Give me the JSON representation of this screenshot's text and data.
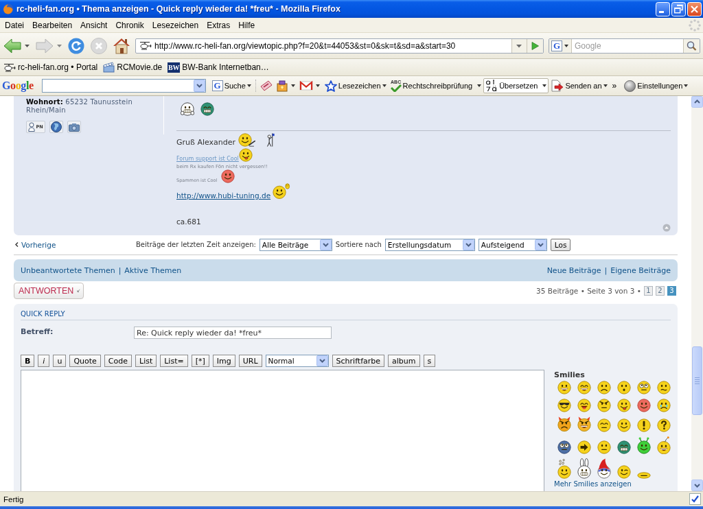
{
  "window": {
    "title": "rc-heli-fan.org • Thema anzeigen - Quick reply wieder da! *freu* - Mozilla Firefox"
  },
  "menu_bar": [
    "Datei",
    "Bearbeiten",
    "Ansicht",
    "Chronik",
    "Lesezeichen",
    "Extras",
    "Hilfe"
  ],
  "nav_toolbar": {
    "url": "http://www.rc-heli-fan.org/viewtopic.php?f=20&t=44053&st=0&sk=t&sd=a&start=30",
    "search": {
      "engine_badge": "G",
      "placeholder": "Google"
    }
  },
  "bookmarks": [
    {
      "kind": "helicopter",
      "label": "rc-heli-fan.org • Portal"
    },
    {
      "kind": "clapper",
      "label": "RCMovie.de"
    },
    {
      "kind": "badge",
      "badge": "BW",
      "label": "BW-Bank Internetban…"
    }
  ],
  "google_toolbar": {
    "logo": "Google",
    "search_badge": "G",
    "search_button": "Suche",
    "buttons": [
      {
        "kind": "star",
        "label": "Lesezeichen",
        "pressed": false
      },
      {
        "kind": "spellcheck",
        "icon_text": "ABC",
        "label": "Rechtschreibprüfung",
        "pressed": false
      },
      {
        "kind": "translate",
        "label": "Übersetzen",
        "pressed": true
      },
      {
        "kind": "send",
        "label": "Senden an",
        "pressed": false
      }
    ],
    "overflow": "»",
    "settings": "Einstellungen"
  },
  "post": {
    "author": {
      "location_label": "Wohnort:",
      "location": "65232 Taunusstein Rhein/Main",
      "contacts": [
        {
          "kind": "pm",
          "label": "PN"
        },
        {
          "kind": "website"
        },
        {
          "kind": "gallery"
        }
      ]
    },
    "smilies": [
      {
        "kind": "thumbs"
      },
      {
        "kind": "mrgreen"
      }
    ],
    "signature": [
      {
        "kind": "text",
        "text": "Gruß Alexander",
        "smilies": [
          {
            "kind": "pen"
          },
          {
            "kind": "flagman"
          }
        ]
      },
      {
        "kind": "small_link",
        "text": "Forum support ist Cool",
        "smilies": [
          {
            "kind": "razz"
          }
        ]
      },
      {
        "kind": "tiny",
        "text": "beim Rx kaufen Fön nicht vergessen!!"
      },
      {
        "kind": "micro",
        "text": "Spammen ist Cool",
        "smilies": [
          {
            "kind": "blush"
          }
        ]
      },
      {
        "kind": "link",
        "text": "http://www.hubi-tuning.de",
        "smilies": [
          {
            "kind": "wave"
          }
        ]
      }
    ],
    "footer": "ca.681"
  },
  "topic_nav": {
    "previous": "Vorherige",
    "filter_label": "Beiträge der letzten Zeit anzeigen:",
    "filter_value": "Alle Beiträge",
    "sort_label": "Sortiere nach",
    "sort_key": "Erstellungsdatum",
    "sort_order": "Aufsteigend",
    "go": "Los"
  },
  "link_bar": {
    "separator": "|",
    "left": [
      "Unbeantwortete Themen",
      "Aktive Themen"
    ],
    "right": [
      "Neue Beiträge",
      "Eigene Beiträge"
    ]
  },
  "action_bar": {
    "reply": "ANTWORTEN",
    "summary": "35 Beiträge • Seite 3 von 3 •",
    "pages": [
      {
        "label": "1",
        "selected": false
      },
      {
        "label": "2",
        "selected": false
      },
      {
        "label": "3",
        "selected": true
      }
    ]
  },
  "quick_reply": {
    "title": "QUICK REPLY",
    "subject_label": "Betreff:",
    "subject": "Re: Quick reply wieder da! *freu*",
    "toolbar": [
      {
        "kind": "bold_button",
        "label": "B"
      },
      {
        "kind": "italic_button",
        "label": "i"
      },
      {
        "kind": "button",
        "label": "u"
      },
      {
        "kind": "button",
        "label": "Quote"
      },
      {
        "kind": "button",
        "label": "Code"
      },
      {
        "kind": "button",
        "label": "List"
      },
      {
        "kind": "button",
        "label": "List="
      },
      {
        "kind": "button",
        "label": "[*]"
      },
      {
        "kind": "button",
        "label": "Img"
      },
      {
        "kind": "button",
        "label": "URL"
      },
      {
        "kind": "select",
        "label": "Normal"
      },
      {
        "kind": "button",
        "label": "Schriftfarbe"
      },
      {
        "kind": "button",
        "label": "album"
      },
      {
        "kind": "button",
        "label": "s"
      }
    ],
    "smilies_title": "Smilies",
    "smilies": [
      {
        "kind": "grin"
      },
      {
        "kind": "laugh"
      },
      {
        "kind": "sad"
      },
      {
        "kind": "surprised"
      },
      {
        "kind": "eek"
      },
      {
        "kind": "confused"
      },
      {
        "kind": "cool"
      },
      {
        "kind": "beam"
      },
      {
        "kind": "mad"
      },
      {
        "kind": "razz"
      },
      {
        "kind": "blush"
      },
      {
        "kind": "cry"
      },
      {
        "kind": "evil"
      },
      {
        "kind": "twisted"
      },
      {
        "kind": "neutral"
      },
      {
        "kind": "smile"
      },
      {
        "kind": "exclaim"
      },
      {
        "kind": "question"
      },
      {
        "kind": "rolleyes"
      },
      {
        "kind": "arrow"
      },
      {
        "kind": "ponder"
      },
      {
        "kind": "mrgreen"
      },
      {
        "kind": "alien"
      },
      {
        "kind": "bomb"
      },
      {
        "kind": "bubbles"
      },
      {
        "kind": "bunny"
      },
      {
        "kind": "gnome"
      },
      {
        "kind": "wink"
      },
      {
        "kind": "flat"
      }
    ],
    "more_smilies": "Mehr Smilies anzeigen"
  },
  "status_bar": {
    "text": "Fertig"
  }
}
